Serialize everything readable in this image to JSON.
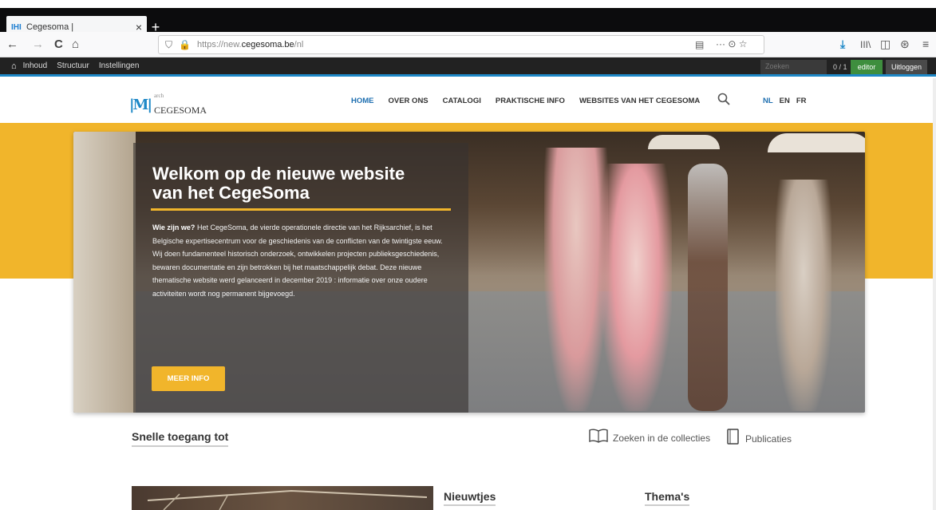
{
  "browser": {
    "tab_title": "Cegesoma |",
    "tab_favicon": "IHI",
    "close": "×",
    "new_tab": "+",
    "url_prefix": "https://new.",
    "url_domain": "cegesoma.be",
    "url_path": "/nl",
    "back": "←",
    "forward": "→",
    "reload": "C",
    "home": "⌂",
    "shield": "⛉",
    "lock": "🔒",
    "reader": "▤",
    "more": "··· ⊙ ☆",
    "download": "⤓",
    "library": "III\\",
    "sidebar": "◫",
    "account": "⊛",
    "hamburger": "≡"
  },
  "cms_bar": {
    "home_icon": "⌂",
    "items": [
      "Inhoud",
      "Structuur",
      "Instellingen"
    ],
    "search_placeholder": "Zoeken",
    "count": "0 / 1",
    "editor": "editor",
    "logout": "Uitloggen"
  },
  "site": {
    "logo_mark": "|M|",
    "logo_prefix": "arch",
    "logo_name": "CEGESOMA",
    "menu": [
      "HOME",
      "OVER ONS",
      "CATALOGI",
      "PRAKTISCHE INFO",
      "WEBSITES VAN HET CEGESOMA"
    ],
    "search_icon": "⚲",
    "langs": [
      "NL",
      "EN",
      "FR"
    ]
  },
  "hero": {
    "title": "Welkom op de nieuwe website van het CegeSoma",
    "intro_bold": "Wie zijn we?",
    "body": " Het CegeSoma, de vierde operationele directie van het Rijksarchief, is het Belgische expertisecentrum voor de geschiedenis van de conflicten van de twintigste eeuw. Wij doen fundamenteel historisch onderzoek, ontwikkelen projecten publieksgeschiedenis, bewaren documentatie en zijn betrokken bij het maatschappelijk debat. Deze nieuwe thematische website werd gelanceerd in december 2019 : informatie over onze oudere activiteiten wordt nog permanent bijgevoegd.",
    "button": "MEER INFO"
  },
  "quick": {
    "title": "Snelle toegang tot",
    "links": [
      {
        "label": "Zoeken in de collecties",
        "icon": "📖"
      },
      {
        "label": "Publicaties",
        "icon": "▯"
      }
    ]
  },
  "sections": {
    "news": "Nieuwtjes",
    "themes": "Thema's"
  }
}
